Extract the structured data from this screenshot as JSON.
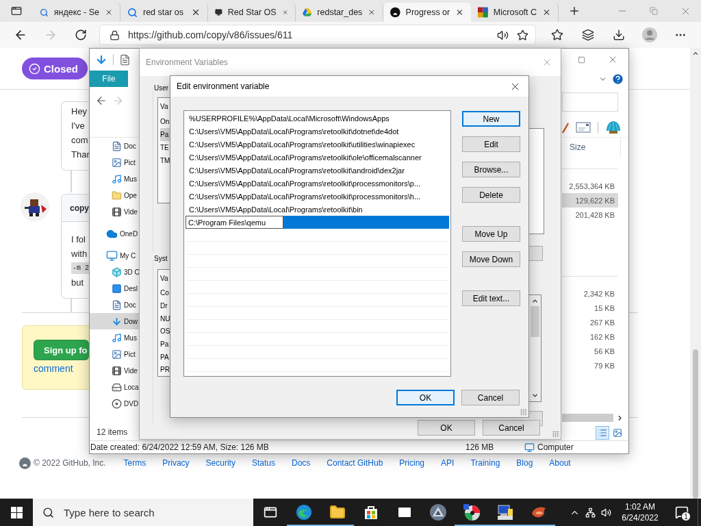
{
  "browser": {
    "tabs": [
      {
        "kind": "search",
        "title": "яндекс - Se",
        "selected": false
      },
      {
        "kind": "search",
        "title": "red star os",
        "selected": false
      },
      {
        "kind": "monitor",
        "title": "Red Star OS",
        "selected": false
      },
      {
        "kind": "drive",
        "title": "redstar_des",
        "selected": false
      },
      {
        "kind": "github",
        "title": "Progress or",
        "selected": true
      },
      {
        "kind": "office",
        "title": "Microsoft C",
        "selected": false
      }
    ],
    "url": "https://github.com/copy/v86/issues/611"
  },
  "issue": {
    "status": "Closed",
    "first_comment": [
      "Hey",
      "I've",
      "com",
      "Thar"
    ],
    "second_comment": {
      "author": "copy",
      "lines": [
        {
          "kind": "text",
          "text": "I fol"
        },
        {
          "kind": "text",
          "text": "with"
        },
        {
          "kind": "code",
          "text": "-m 2"
        },
        {
          "kind": "text",
          "text": "but"
        }
      ]
    },
    "signup": {
      "button": "Sign up fo",
      "link": "comment"
    }
  },
  "footer": {
    "copyright": "© 2022 GitHub, Inc.",
    "links": [
      "Terms",
      "Privacy",
      "Security",
      "Status",
      "Docs",
      "Contact GitHub",
      "Pricing",
      "API",
      "Training",
      "Blog",
      "About"
    ]
  },
  "explorer": {
    "ribbon_tab": "File",
    "quick_access": [
      {
        "kind": "documents",
        "label": "Doc",
        "selected": false
      },
      {
        "kind": "pictures",
        "label": "Pict",
        "selected": false
      },
      {
        "kind": "music",
        "label": "Mus",
        "selected": false
      },
      {
        "kind": "folder",
        "label": "Ope",
        "selected": false
      },
      {
        "kind": "videos",
        "label": "Vide",
        "selected": false
      }
    ],
    "tree": [
      {
        "kind": "cloud",
        "label": "OneD",
        "selected": false
      },
      {
        "kind": "computer",
        "label": "My C",
        "selected": false,
        "children": [
          {
            "kind": "cube",
            "label": "3D C",
            "selected": false
          },
          {
            "kind": "desktop",
            "label": "Desl",
            "selected": false
          },
          {
            "kind": "documents",
            "label": "Doc",
            "selected": false
          },
          {
            "kind": "downloads",
            "label": "Dow",
            "selected": true
          },
          {
            "kind": "music",
            "label": "Mus",
            "selected": false
          },
          {
            "kind": "pictures",
            "label": "Pict",
            "selected": false
          },
          {
            "kind": "videos",
            "label": "Vide",
            "selected": false
          },
          {
            "kind": "drive",
            "label": "Loca",
            "selected": false
          },
          {
            "kind": "disc",
            "label": "DVD",
            "selected": false
          }
        ]
      }
    ],
    "size_header": "Size",
    "size_groups": [
      [
        {
          "size": "2,553,364 KB",
          "selected": false
        },
        {
          "size": "129,622 KB",
          "selected": true
        },
        {
          "size": "201,428 KB",
          "selected": false
        }
      ],
      [
        {
          "size": "2,342 KB",
          "selected": false
        },
        {
          "size": "15 KB",
          "selected": false
        },
        {
          "size": "267 KB",
          "selected": false
        },
        {
          "size": "162 KB",
          "selected": false
        },
        {
          "size": "56 KB",
          "selected": false
        },
        {
          "size": "79 KB",
          "selected": false
        }
      ]
    ],
    "item_count": "12 items",
    "details": {
      "summary": "Date created: 6/24/2022 12:59 AM, Size: 126 MB",
      "size": "126 MB",
      "location": "Computer"
    }
  },
  "env_dialog": {
    "title": "Environment Variables",
    "user_label": "User",
    "user_header": "Va",
    "user_rows": [
      {
        "text": "On",
        "selected": false
      },
      {
        "text": "Pa",
        "selected": true
      },
      {
        "text": "TE",
        "selected": false
      },
      {
        "text": "TM",
        "selected": false
      }
    ],
    "system_label": "Syst",
    "system_header": "Va",
    "system_rows": [
      {
        "text": "Co",
        "selected": false
      },
      {
        "text": "Dr",
        "selected": false
      },
      {
        "text": "NU",
        "selected": false
      },
      {
        "text": "OS",
        "selected": false
      },
      {
        "text": "Pa",
        "selected": false
      },
      {
        "text": "PA",
        "selected": false
      },
      {
        "text": "PR",
        "selected": false
      }
    ],
    "buttons": [
      {
        "label": "OK",
        "focused": false
      },
      {
        "label": "Cancel",
        "focused": false
      }
    ]
  },
  "edit_dialog": {
    "title": "Edit environment variable",
    "entries": [
      "%USERPROFILE%\\AppData\\Local\\Microsoft\\WindowsApps",
      "C:\\Users\\VM5\\AppData\\Local\\Programs\\retoolkit\\dotnet\\de4dot",
      "C:\\Users\\VM5\\AppData\\Local\\Programs\\retoolkit\\utilities\\winapiexec",
      "C:\\Users\\VM5\\AppData\\Local\\Programs\\retoolkit\\ole\\officemalscanner",
      "C:\\Users\\VM5\\AppData\\Local\\Programs\\retoolkit\\android\\dex2jar",
      "C:\\Users\\VM5\\AppData\\Local\\Programs\\retoolkit\\processmonitors\\p...",
      "C:\\Users\\VM5\\AppData\\Local\\Programs\\retoolkit\\processmonitors\\h...",
      "C:\\Users\\VM5\\AppData\\Local\\Programs\\retoolkit\\bin"
    ],
    "editing": {
      "value": "C:\\Program Files\\qemu",
      "selected": true
    },
    "button_groups": [
      [
        {
          "label": "New",
          "focused": true
        },
        {
          "label": "Edit",
          "focused": false
        },
        {
          "label": "Browse...",
          "focused": false
        },
        {
          "label": "Delete",
          "focused": false
        }
      ],
      [
        {
          "label": "Move Up",
          "focused": false
        },
        {
          "label": "Move Down",
          "focused": false
        }
      ],
      [
        {
          "label": "Edit text...",
          "focused": false
        }
      ]
    ],
    "confirm": [
      {
        "label": "OK",
        "focused": true
      },
      {
        "label": "Cancel",
        "focused": false
      }
    ]
  },
  "taskbar": {
    "search_placeholder": "Type here to search",
    "apps": [
      {
        "kind": "task-view",
        "running": false
      },
      {
        "kind": "edge",
        "running": true
      },
      {
        "kind": "folder",
        "running": true
      },
      {
        "kind": "store",
        "running": false
      },
      {
        "kind": "mail",
        "running": false
      },
      {
        "kind": "triangle",
        "running": false
      },
      {
        "kind": "disc",
        "running": true
      },
      {
        "kind": "computer",
        "running": true
      },
      {
        "kind": "bird",
        "running": true
      }
    ],
    "time": "1:02 AM",
    "date": "6/24/2022",
    "notifications": "1"
  }
}
